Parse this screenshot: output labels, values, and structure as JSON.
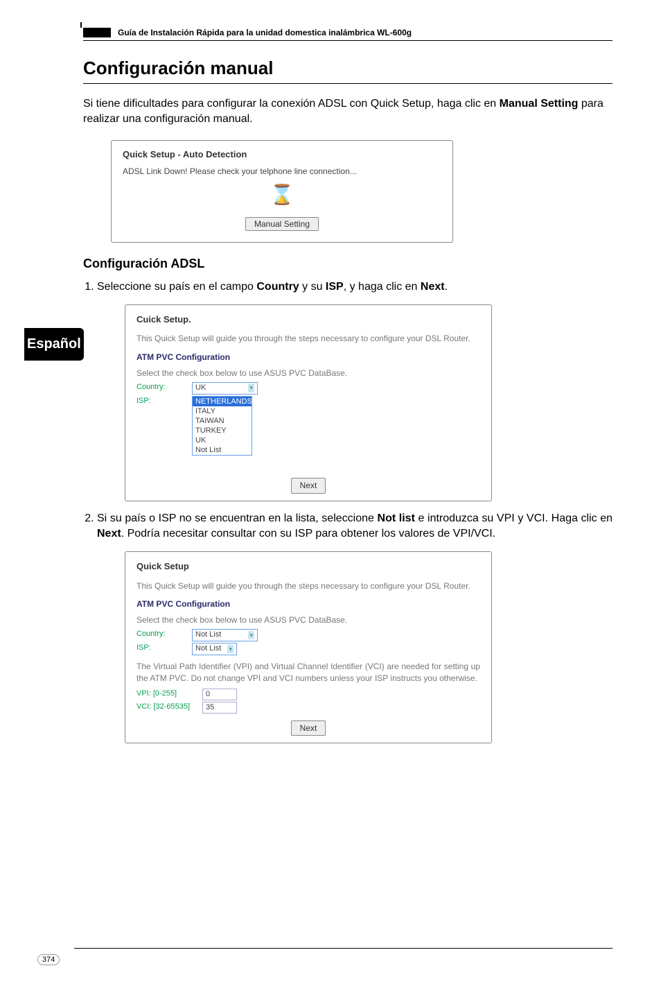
{
  "header": {
    "doc_title": "Guía de Instalación Rápida para la unidad domestica inalámbrica WL-600g"
  },
  "title": "Configuración manual",
  "intro_pre": "Si tiene dificultades para configurar la conexión ADSL con Quick Setup, haga clic en ",
  "intro_bold": "Manual Setting",
  "intro_post": " para realizar una configuración manual.",
  "ss1": {
    "title": "Quick Setup - Auto Detection",
    "text": "ADSL Link Down! Please check your telphone line connection...",
    "button": "Manual Setting"
  },
  "subheading": "Configuración ADSL",
  "step1_pre": "Seleccione su país en el campo ",
  "step1_b1": "Country",
  "step1_mid": " y su ",
  "step1_b2": "ISP",
  "step1_mid2": ", y haga clic en ",
  "step1_b3": "Next",
  "step1_post": ".",
  "ss2": {
    "title": "Cuick Setup.",
    "desc": "This Quick Setup will guide you through the steps necessary to configure your DSL Router.",
    "section": "ATM PVC Configuration",
    "select_label": "Select the check box below to use ASUS PVC DataBase.",
    "country_label": "Country:",
    "isp_label": "ISP:",
    "country_value": "UK",
    "isp_options": [
      "NETHERLANDS",
      "ITALY",
      "TAIWAN",
      "TURKEY",
      "UK",
      "Not List"
    ],
    "button": "Next"
  },
  "step2_pre": "Si su país o ISP no se encuentran en la lista, seleccione ",
  "step2_b1": "Not list",
  "step2_mid": " e introduzca su VPI y VCI. Haga clic en ",
  "step2_b2": "Next",
  "step2_post": ". Podría necesitar consultar con su ISP para obtener  los valores de VPI/VCI.",
  "ss3": {
    "title": "Quick Setup",
    "desc": "This Quick Setup will guide you through the steps necessary to configure your DSL Router.",
    "section": "ATM PVC Configuration",
    "select_label": "Select the check box below to use ASUS PVC DataBase.",
    "country_label": "Country:",
    "isp_label": "ISP:",
    "country_value": "Not List",
    "isp_value": "Not List",
    "vpvc_text": "The Virtual Path Identifier (VPI) and Virtual Channel Identifier (VCI) are needed for setting up the ATM PVC. Do not change VPI and VCI numbers unless your ISP instructs you otherwise.",
    "vpi_label": "VPI: [0-255]",
    "vpi_value": "0",
    "vci_label": "VCI: [32-65535]",
    "vci_value": "35",
    "button": "Next"
  },
  "side_label": "Español",
  "page_number": "374"
}
